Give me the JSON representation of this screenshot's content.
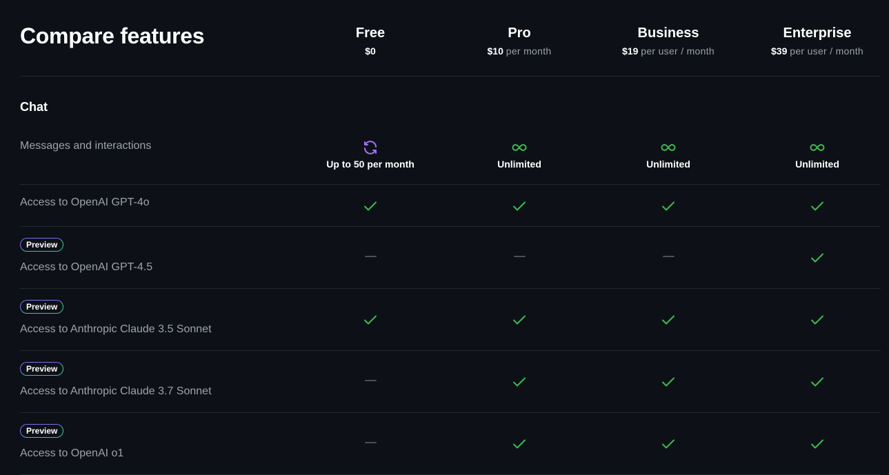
{
  "page": {
    "title": "Compare features",
    "section_title": "Chat",
    "preview_badge": "Preview"
  },
  "colors": {
    "background": "#0d1117",
    "check": "#3fb950",
    "infinity": "#3fb950",
    "refresh": "#a371f7",
    "dash": "#4b5057",
    "muted_text": "#9ea3a9"
  },
  "plans": [
    {
      "name": "Free",
      "price": "$0",
      "period": ""
    },
    {
      "name": "Pro",
      "price": "$10",
      "period": "per month"
    },
    {
      "name": "Business",
      "price": "$19",
      "period": "per user / month"
    },
    {
      "name": "Enterprise",
      "price": "$39",
      "period": "per user / month"
    }
  ],
  "features": [
    {
      "label": "Messages and interactions",
      "preview": false,
      "values": [
        {
          "icon": "refresh-icon",
          "text": "Up to 50 per month"
        },
        {
          "icon": "infinity-icon",
          "text": "Unlimited"
        },
        {
          "icon": "infinity-icon",
          "text": "Unlimited"
        },
        {
          "icon": "infinity-icon",
          "text": "Unlimited"
        }
      ]
    },
    {
      "label": "Access to OpenAI GPT-4o",
      "preview": false,
      "values": [
        {
          "icon": "check-icon"
        },
        {
          "icon": "check-icon"
        },
        {
          "icon": "check-icon"
        },
        {
          "icon": "check-icon"
        }
      ]
    },
    {
      "label": "Access to OpenAI GPT-4.5",
      "preview": true,
      "values": [
        {
          "icon": "dash-icon"
        },
        {
          "icon": "dash-icon"
        },
        {
          "icon": "dash-icon"
        },
        {
          "icon": "check-icon"
        }
      ]
    },
    {
      "label": "Access to Anthropic Claude 3.5 Sonnet",
      "preview": true,
      "values": [
        {
          "icon": "check-icon"
        },
        {
          "icon": "check-icon"
        },
        {
          "icon": "check-icon"
        },
        {
          "icon": "check-icon"
        }
      ]
    },
    {
      "label": "Access to Anthropic Claude 3.7 Sonnet",
      "preview": true,
      "values": [
        {
          "icon": "dash-icon"
        },
        {
          "icon": "check-icon"
        },
        {
          "icon": "check-icon"
        },
        {
          "icon": "check-icon"
        }
      ]
    },
    {
      "label": "Access to OpenAI o1",
      "preview": true,
      "values": [
        {
          "icon": "dash-icon"
        },
        {
          "icon": "check-icon"
        },
        {
          "icon": "check-icon"
        },
        {
          "icon": "check-icon"
        }
      ]
    }
  ]
}
